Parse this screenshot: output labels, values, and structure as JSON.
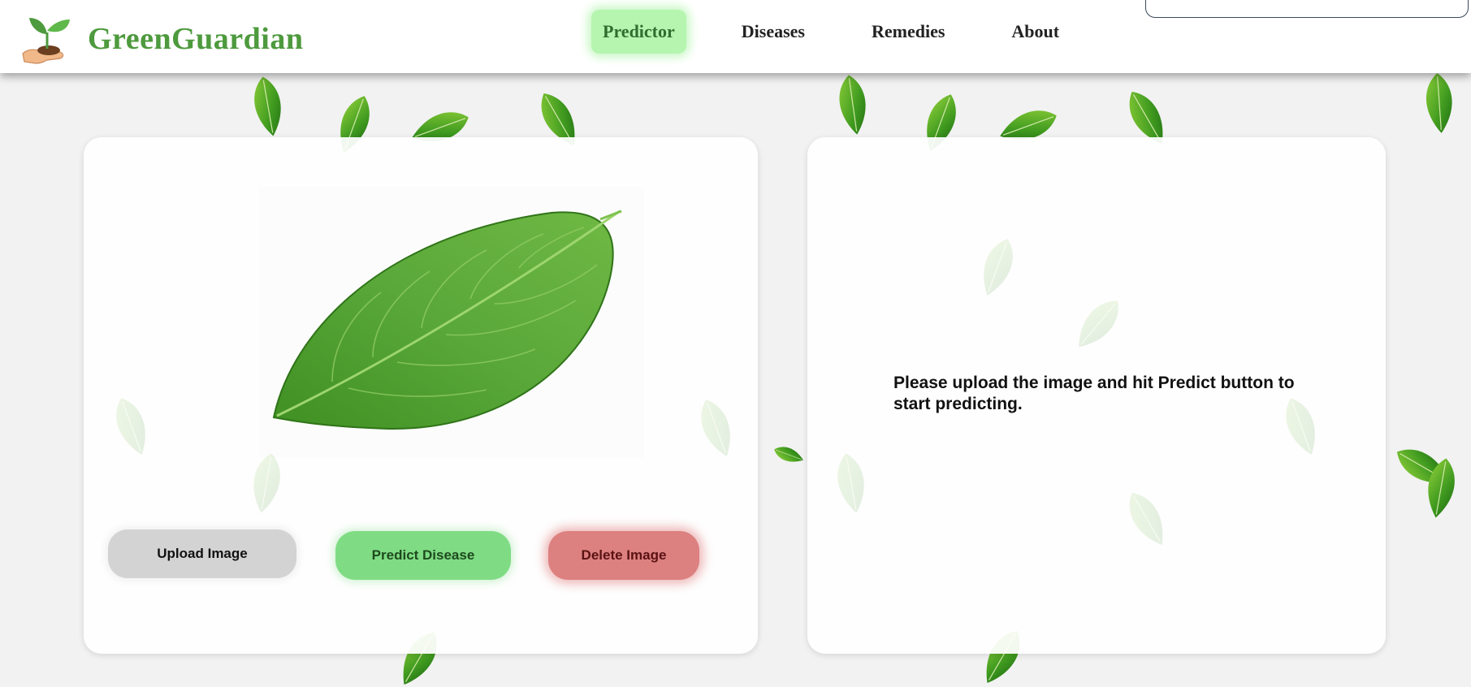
{
  "brand": {
    "name": "GreenGuardian",
    "color": "#4e9a3e",
    "logo_icon": "plant-in-hand-icon"
  },
  "nav": {
    "items": [
      {
        "label": "Predictor",
        "active": true
      },
      {
        "label": "Diseases",
        "active": false
      },
      {
        "label": "Remedies",
        "active": false
      },
      {
        "label": "About",
        "active": false
      }
    ],
    "active_color": "#b5f5b0"
  },
  "search": {
    "value": "",
    "placeholder": ""
  },
  "predictor": {
    "preview_image": "green-leaf-image",
    "buttons": {
      "upload": "Upload Image",
      "predict": "Predict Disease",
      "delete": "Delete Image"
    },
    "colors": {
      "upload": "#d3d3d3",
      "predict": "#7fdc84",
      "delete": "#dc8080"
    }
  },
  "result": {
    "message": "Please upload the image and hit Predict button to start predicting."
  },
  "background": {
    "color": "#f2f2f2",
    "decoration": "falling-leaves"
  }
}
